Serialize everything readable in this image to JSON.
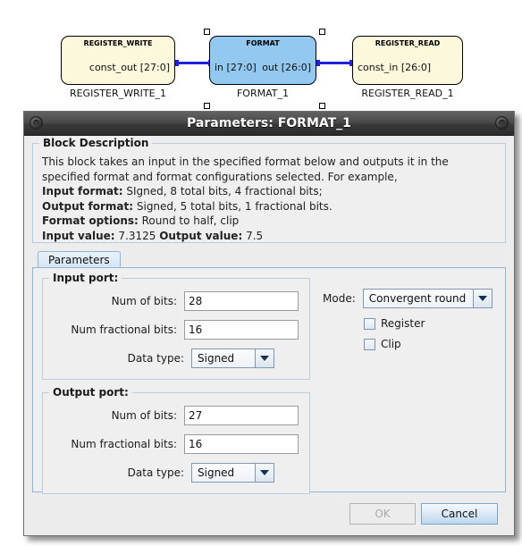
{
  "canvas": {
    "blocks": [
      {
        "type": "REGISTER_WRITE",
        "title": "REGISTER_WRITE",
        "port_right": "const_out [27:0]",
        "instance_label": "REGISTER_WRITE_1",
        "fill": "#fbf8dc"
      },
      {
        "type": "FORMAT",
        "title": "FORMAT",
        "port_left": "in [27:0]",
        "port_right": "out [26:0]",
        "instance_label": "FORMAT_1",
        "fill": "#93c8f0",
        "selected": true
      },
      {
        "type": "REGISTER_READ",
        "title": "REGISTER_READ",
        "port_left": "const_in [26:0]",
        "instance_label": "REGISTER_READ_1",
        "fill": "#fbf8dc"
      }
    ],
    "wire_color": "#2222dd"
  },
  "dialog": {
    "title": "Parameters: FORMAT_1",
    "description": {
      "legend": "Block Description",
      "line1": "This block takes an input in the specified format below and outputs it in the",
      "line2": "specified format and format configurations selected. For example,",
      "input_format_label": "Input format:",
      "input_format_value": " SIgned, 8 total bits, 4 fractional bits;",
      "output_format_label": "Output format:",
      "output_format_value": " Signed, 5 total bits, 1 fractional bits.",
      "format_options_label": "Format options:",
      "format_options_value": " Round to half, clip",
      "input_value_label": "Input value:",
      "input_value_value": " 7.3125 ",
      "output_value_label": "Output value:",
      "output_value_value": " 7.5"
    },
    "tabs": [
      {
        "label": "Parameters",
        "active": true
      }
    ],
    "input_port": {
      "legend": "Input port:",
      "num_bits_label": "Num of bits:",
      "num_bits_value": "28",
      "num_frac_label": "Num fractional bits:",
      "num_frac_value": "16",
      "data_type_label": "Data type:",
      "data_type_value": "Signed"
    },
    "output_port": {
      "legend": "Output port:",
      "num_bits_label": "Num of bits:",
      "num_bits_value": "27",
      "num_frac_label": "Num fractional bits:",
      "num_frac_value": "16",
      "data_type_label": "Data type:",
      "data_type_value": "Signed"
    },
    "options": {
      "mode_label": "Mode:",
      "mode_value": "Convergent round",
      "register_label": "Register",
      "register_checked": false,
      "clip_label": "Clip",
      "clip_checked": false
    },
    "buttons": {
      "ok_label": "OK",
      "ok_enabled": false,
      "cancel_label": "Cancel",
      "cancel_enabled": true
    }
  }
}
